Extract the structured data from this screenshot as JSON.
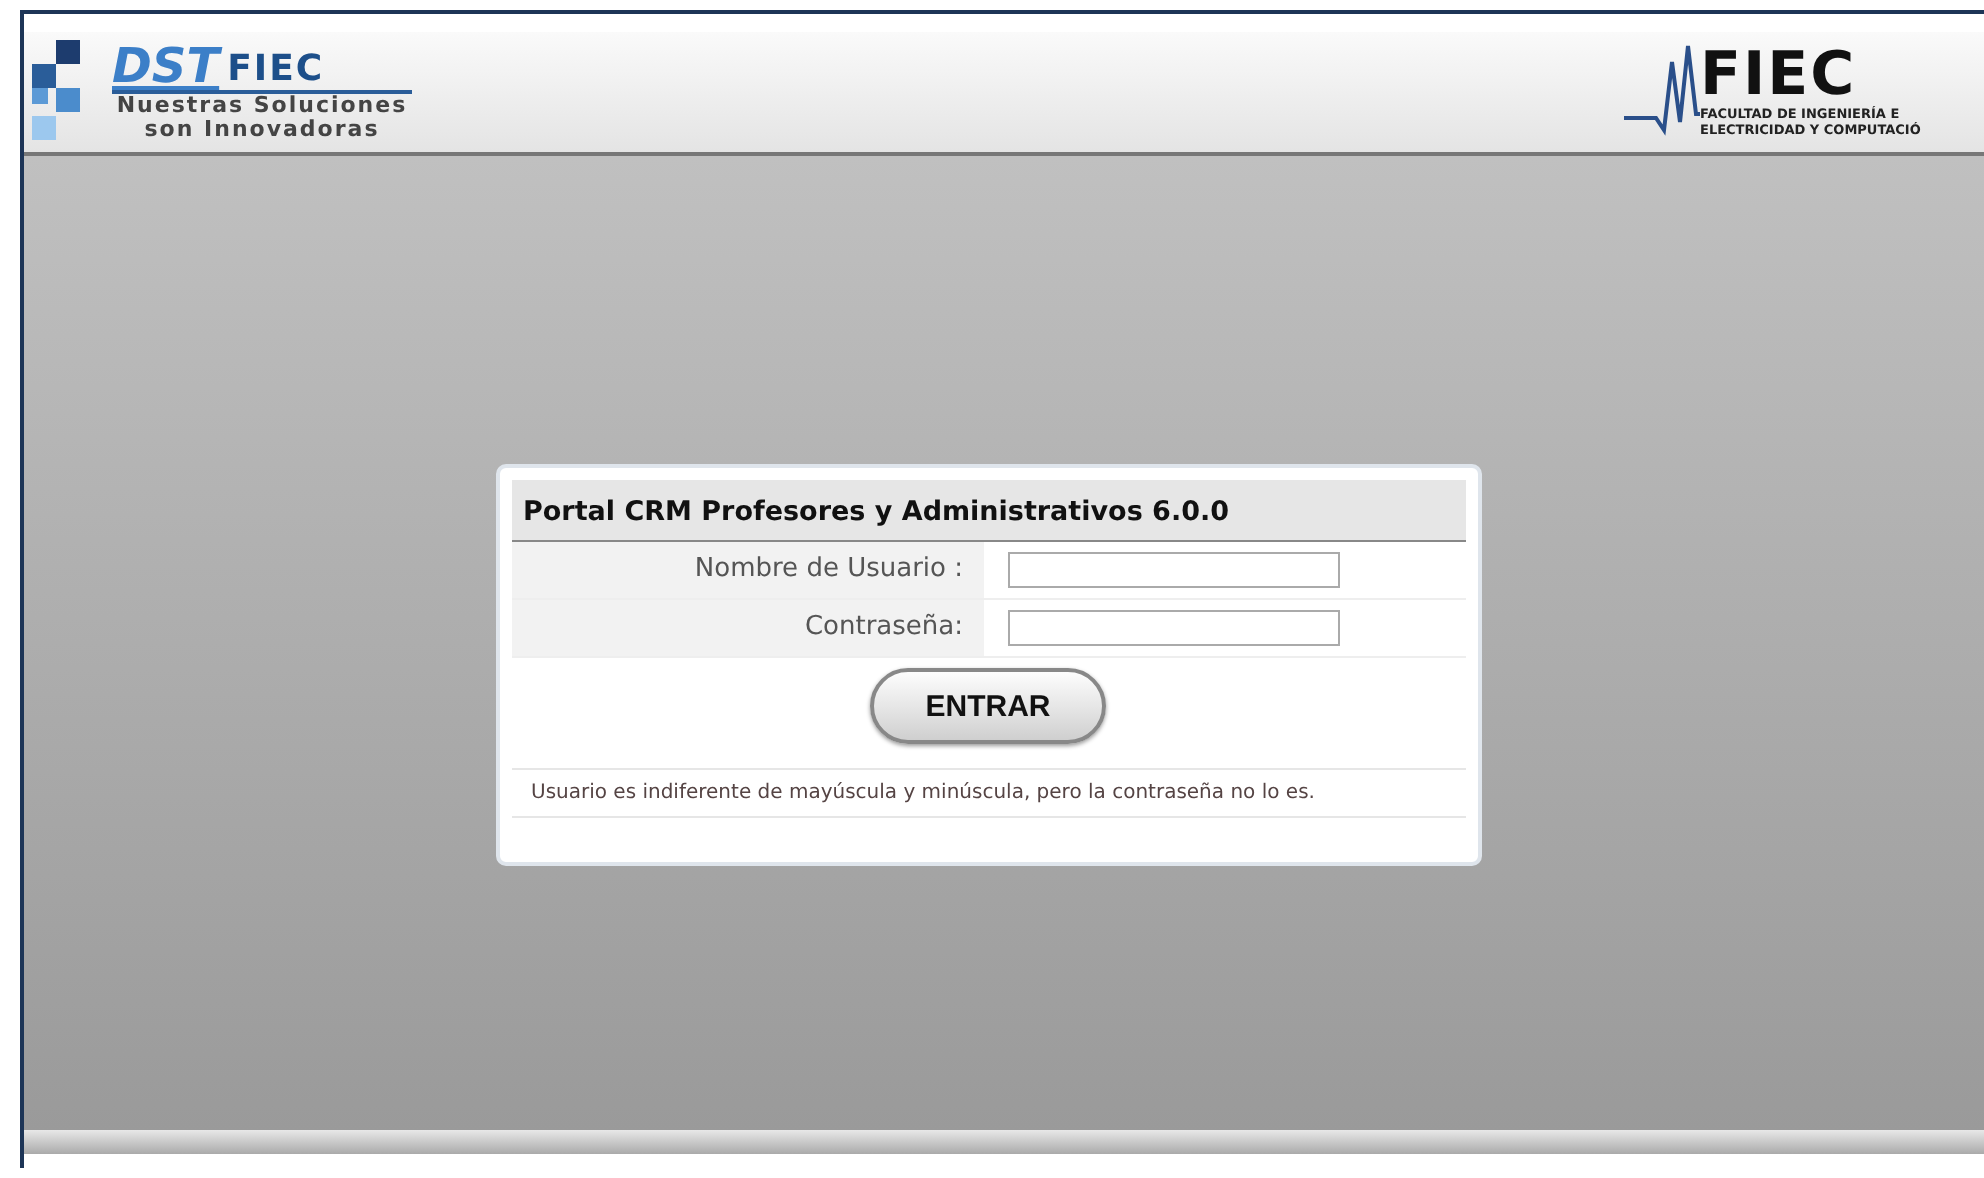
{
  "header": {
    "left_logo": {
      "mark": "DST",
      "sub": "FIEC",
      "tagline": [
        "Nuestras Soluciones",
        "son Innovadoras"
      ]
    },
    "right_logo": {
      "mark": "FIEC",
      "lines": [
        "FACULTAD DE INGENIERÍA E",
        "ELECTRICIDAD Y COMPUTACIÓ"
      ]
    }
  },
  "login": {
    "title": "Portal CRM Profesores y Administrativos 6.0.0",
    "fields": [
      {
        "label": "Nombre de Usuario :"
      },
      {
        "label": "Contraseña:"
      }
    ],
    "button": "ENTRAR",
    "note": "Usuario es indiferente de mayúscula y minúscula, pero la contraseña no lo es."
  }
}
